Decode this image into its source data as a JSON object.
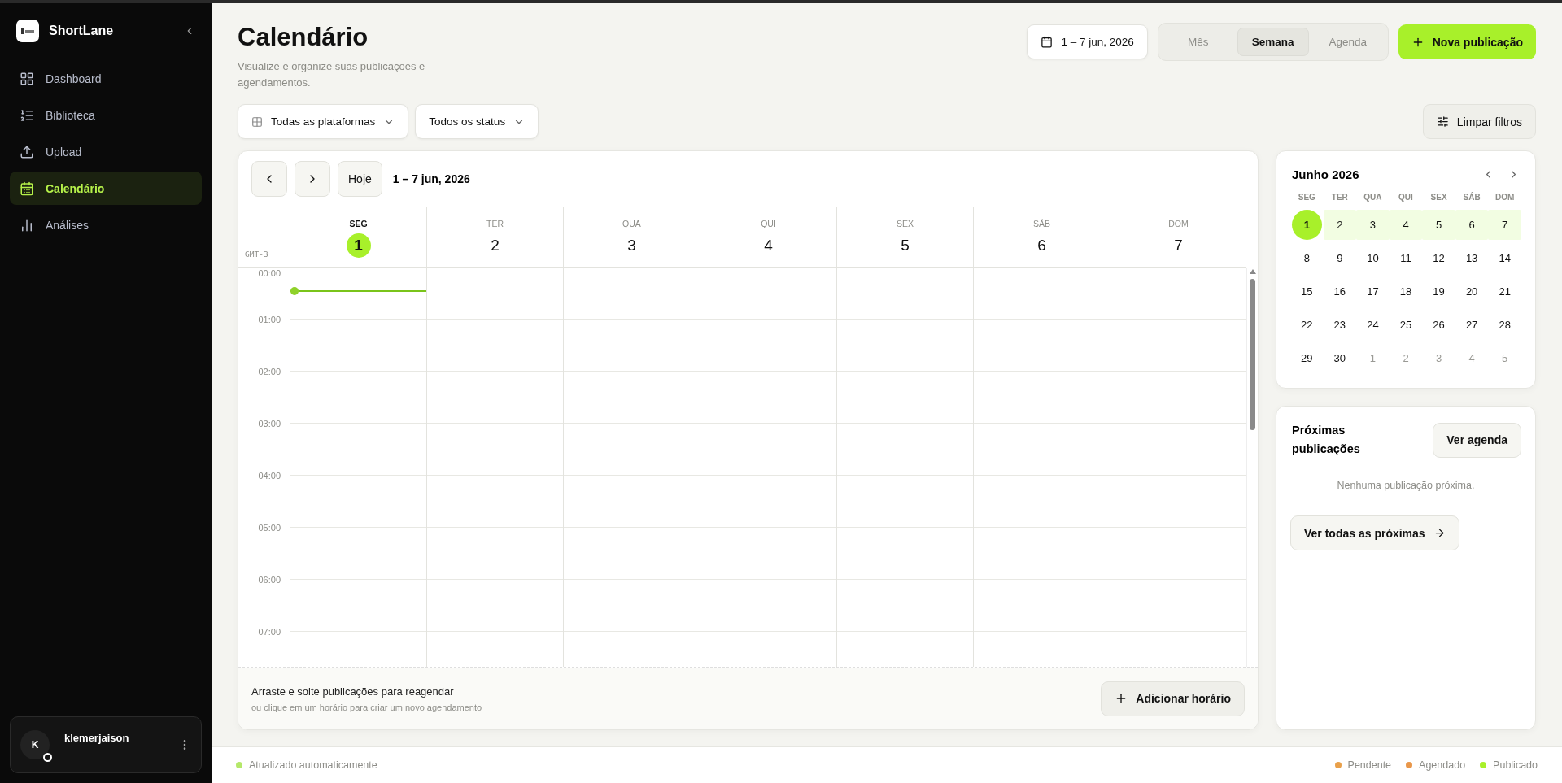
{
  "sidebar": {
    "brand": "ShortLane",
    "items": [
      {
        "label": "Dashboard",
        "selected": false
      },
      {
        "label": "Biblioteca",
        "selected": false
      },
      {
        "label": "Upload",
        "selected": false
      },
      {
        "label": "Calendário",
        "selected": true
      },
      {
        "label": "Análises",
        "selected": false
      }
    ],
    "user": {
      "initial": "K",
      "name": "klemerjaison"
    }
  },
  "header": {
    "title": "Calendário",
    "subtitle": "Visualize e organize suas publicações e agendamentos.",
    "date_range": "1 – 7 jun, 2026",
    "views": [
      {
        "label": "Mês",
        "selected": false
      },
      {
        "label": "Semana",
        "selected": true
      },
      {
        "label": "Agenda",
        "selected": false
      }
    ],
    "primary_button": "Nova publicação"
  },
  "filters": {
    "platform": "Todas as plataformas",
    "status": "Todos os status",
    "clear": "Limpar filtros"
  },
  "week": {
    "today_button": "Hoje",
    "range": "1 – 7 jun, 2026",
    "timezone": "GMT-3",
    "days": [
      {
        "name": "SEG",
        "date": "1",
        "today": true
      },
      {
        "name": "TER",
        "date": "2",
        "today": false
      },
      {
        "name": "QUA",
        "date": "3",
        "today": false
      },
      {
        "name": "QUI",
        "date": "4",
        "today": false
      },
      {
        "name": "SEX",
        "date": "5",
        "today": false
      },
      {
        "name": "SÁB",
        "date": "6",
        "today": false
      },
      {
        "name": "DOM",
        "date": "7",
        "today": false
      }
    ],
    "hours": [
      "00:00",
      "01:00",
      "02:00",
      "03:00",
      "04:00",
      "05:00",
      "06:00",
      "07:00"
    ],
    "hint": "Arraste e solte publicações para reagendar",
    "subhint": "ou clique em um horário para criar um novo agendamento",
    "add_button": "Adicionar horário"
  },
  "mini_calendar": {
    "title": "Junho 2026",
    "weekdays": [
      "SEG",
      "TER",
      "QUA",
      "QUI",
      "SEX",
      "SÁB",
      "DOM"
    ],
    "weeks": [
      [
        {
          "d": "1",
          "today": true,
          "in_week": true,
          "outside": false
        },
        {
          "d": "2",
          "today": false,
          "in_week": true,
          "outside": false
        },
        {
          "d": "3",
          "today": false,
          "in_week": true,
          "outside": false
        },
        {
          "d": "4",
          "today": false,
          "in_week": true,
          "outside": false
        },
        {
          "d": "5",
          "today": false,
          "in_week": true,
          "outside": false
        },
        {
          "d": "6",
          "today": false,
          "in_week": true,
          "outside": false
        },
        {
          "d": "7",
          "today": false,
          "in_week": true,
          "outside": false
        }
      ],
      [
        {
          "d": "8",
          "today": false,
          "in_week": false,
          "outside": false
        },
        {
          "d": "9",
          "today": false,
          "in_week": false,
          "outside": false
        },
        {
          "d": "10",
          "today": false,
          "in_week": false,
          "outside": false
        },
        {
          "d": "11",
          "today": false,
          "in_week": false,
          "outside": false
        },
        {
          "d": "12",
          "today": false,
          "in_week": false,
          "outside": false
        },
        {
          "d": "13",
          "today": false,
          "in_week": false,
          "outside": false
        },
        {
          "d": "14",
          "today": false,
          "in_week": false,
          "outside": false
        }
      ],
      [
        {
          "d": "15",
          "today": false,
          "in_week": false,
          "outside": false
        },
        {
          "d": "16",
          "today": false,
          "in_week": false,
          "outside": false
        },
        {
          "d": "17",
          "today": false,
          "in_week": false,
          "outside": false
        },
        {
          "d": "18",
          "today": false,
          "in_week": false,
          "outside": false
        },
        {
          "d": "19",
          "today": false,
          "in_week": false,
          "outside": false
        },
        {
          "d": "20",
          "today": false,
          "in_week": false,
          "outside": false
        },
        {
          "d": "21",
          "today": false,
          "in_week": false,
          "outside": false
        }
      ],
      [
        {
          "d": "22",
          "today": false,
          "in_week": false,
          "outside": false
        },
        {
          "d": "23",
          "today": false,
          "in_week": false,
          "outside": false
        },
        {
          "d": "24",
          "today": false,
          "in_week": false,
          "outside": false
        },
        {
          "d": "25",
          "today": false,
          "in_week": false,
          "outside": false
        },
        {
          "d": "26",
          "today": false,
          "in_week": false,
          "outside": false
        },
        {
          "d": "27",
          "today": false,
          "in_week": false,
          "outside": false
        },
        {
          "d": "28",
          "today": false,
          "in_week": false,
          "outside": false
        }
      ],
      [
        {
          "d": "29",
          "today": false,
          "in_week": false,
          "outside": false
        },
        {
          "d": "30",
          "today": false,
          "in_week": false,
          "outside": false
        },
        {
          "d": "1",
          "today": false,
          "in_week": false,
          "outside": true
        },
        {
          "d": "2",
          "today": false,
          "in_week": false,
          "outside": true
        },
        {
          "d": "3",
          "today": false,
          "in_week": false,
          "outside": true
        },
        {
          "d": "4",
          "today": false,
          "in_week": false,
          "outside": true
        },
        {
          "d": "5",
          "today": false,
          "in_week": false,
          "outside": true
        }
      ]
    ]
  },
  "upcoming": {
    "title": "Próximas publicações",
    "agenda_button": "Ver agenda",
    "empty": "Nenhuma publicação próxima.",
    "all_button": "Ver todas as próximas"
  },
  "status_bar": {
    "sync": "Atualizado automaticamente",
    "legend": [
      {
        "label": "Pendente",
        "color": "#e9a04a"
      },
      {
        "label": "Agendado",
        "color": "#e9974a"
      },
      {
        "label": "Publicado",
        "color": "#a8f02a"
      }
    ]
  }
}
